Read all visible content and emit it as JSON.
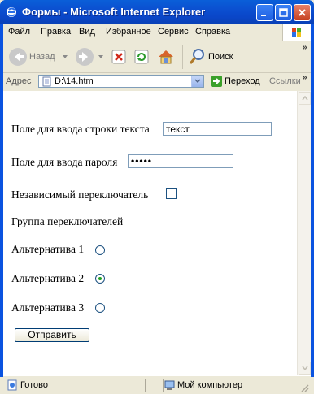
{
  "window": {
    "title": "Формы - Microsoft Internet Explorer"
  },
  "menubar": {
    "items": [
      {
        "label": "Файл"
      },
      {
        "label": "Правка"
      },
      {
        "label": "Вид"
      },
      {
        "label": "Избранное"
      },
      {
        "label": "Сервис"
      },
      {
        "label": "Справка"
      }
    ]
  },
  "toolbar": {
    "back_label": "Назад",
    "search_label": "Поиск"
  },
  "addressbar": {
    "label": "Адрес",
    "value": "D:\\14.htm",
    "go_label": "Переход",
    "links_label": "Ссылки"
  },
  "form": {
    "text_label": "Поле для ввода строки текста",
    "text_value": "текст",
    "password_label": "Поле для ввода пароля",
    "password_value": "•••••",
    "checkbox_label": "Независимый переключатель",
    "checkbox_checked": false,
    "group_label": "Группа переключателей",
    "radios": [
      {
        "label": "Альтернатива 1",
        "checked": false
      },
      {
        "label": "Альтернатива 2",
        "checked": true
      },
      {
        "label": "Альтернатива 3",
        "checked": false
      }
    ],
    "submit_label": "Отправить"
  },
  "statusbar": {
    "status": "Готово",
    "zone": "Мой компьютер"
  },
  "colors": {
    "titlebar": "#0a53e0",
    "radio_checked": "#21a121",
    "input_border": "#7f9db9"
  }
}
